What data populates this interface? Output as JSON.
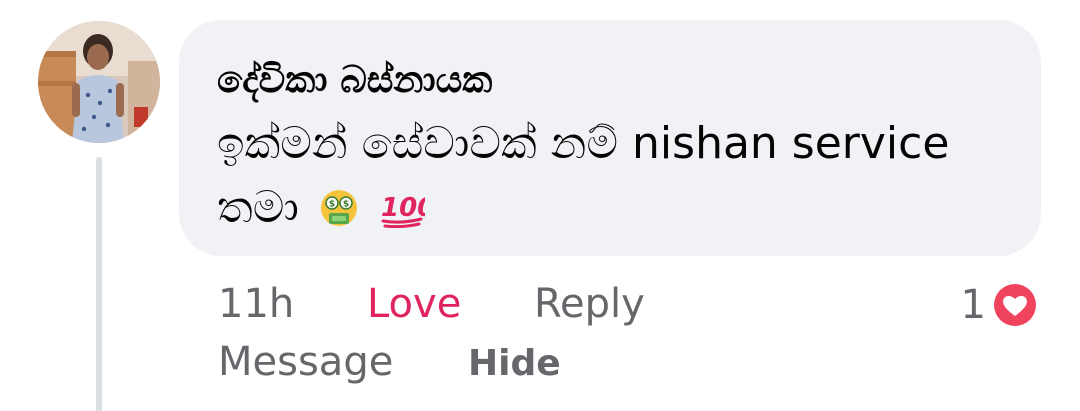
{
  "comment": {
    "author": "දේවිකා බස්නායක",
    "text": "ඉක්මන් සේවාවක් නම් nishan service තමා",
    "emojis": [
      "money-mouth-face-icon",
      "hundred-points-icon"
    ],
    "avatar": "profile-photo"
  },
  "actions": {
    "time": "11h",
    "love_label": "Love",
    "reply_label": "Reply",
    "message_label": "Message",
    "hide_label": "Hide"
  },
  "reactions": {
    "count": "1",
    "type": "love-reaction-icon"
  },
  "colors": {
    "bubble": "#f0f2f5",
    "love": "#e0245e",
    "secondary_text": "#65676b",
    "thread_line": "#dadde1"
  }
}
